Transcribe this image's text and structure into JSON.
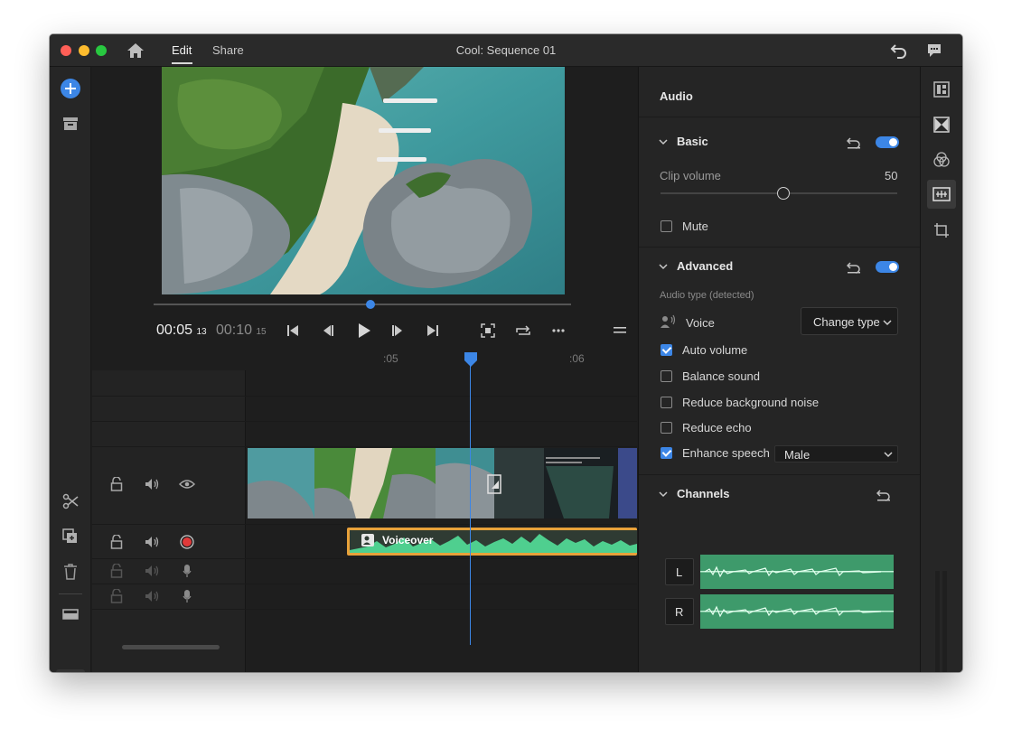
{
  "app": {
    "tabs": [
      {
        "label": "Edit"
      },
      {
        "label": "Share"
      }
    ],
    "title": "Cool: Sequence 01"
  },
  "colors": {
    "accent": "#3c86e6",
    "record": "#e03a3a",
    "voiceover_clip": "#e8a13a",
    "waveform": "#4fcf8f",
    "channel_bg": "#3e9a6b"
  },
  "icons": {
    "top": [
      "home-icon",
      "undo-icon",
      "feedback-icon"
    ],
    "left_toolbar": [
      "add-media-icon",
      "project-icon",
      "scissors-icon",
      "duplicate-icon",
      "trash-icon",
      "track-toggle-icon",
      "timeline-view-icon"
    ],
    "right_toolbar": [
      "info-panel-icon",
      "transitions-icon",
      "color-icon",
      "audio-panel-icon",
      "crop-icon"
    ]
  },
  "player": {
    "current_time": "00:05",
    "current_frames": "13",
    "duration_time": "00:10",
    "duration_frames": "15",
    "scrub_fraction": 0.52
  },
  "timeline": {
    "ruler": [
      ":05",
      ":06"
    ],
    "playhead_fraction": 0.57,
    "voiceover_label": "Voiceover"
  },
  "audio_panel": {
    "title": "Audio",
    "basic": {
      "label": "Basic",
      "enabled": true,
      "clip_volume_label": "Clip volume",
      "clip_volume_value": "50",
      "volume_fraction": 0.52,
      "mute_label": "Mute",
      "mute": false
    },
    "advanced": {
      "label": "Advanced",
      "enabled": true,
      "audio_type_label": "Audio type (detected)",
      "audio_type": "Voice",
      "change_type_label": "Change type",
      "options": [
        {
          "label": "Auto volume",
          "checked": true
        },
        {
          "label": "Balance sound",
          "checked": false
        },
        {
          "label": "Reduce background noise",
          "checked": false
        },
        {
          "label": "Reduce echo",
          "checked": false
        },
        {
          "label": "Enhance speech",
          "checked": true
        }
      ],
      "speech_voice": "Male"
    },
    "channels": {
      "label": "Channels",
      "left": "L",
      "right": "R"
    }
  }
}
